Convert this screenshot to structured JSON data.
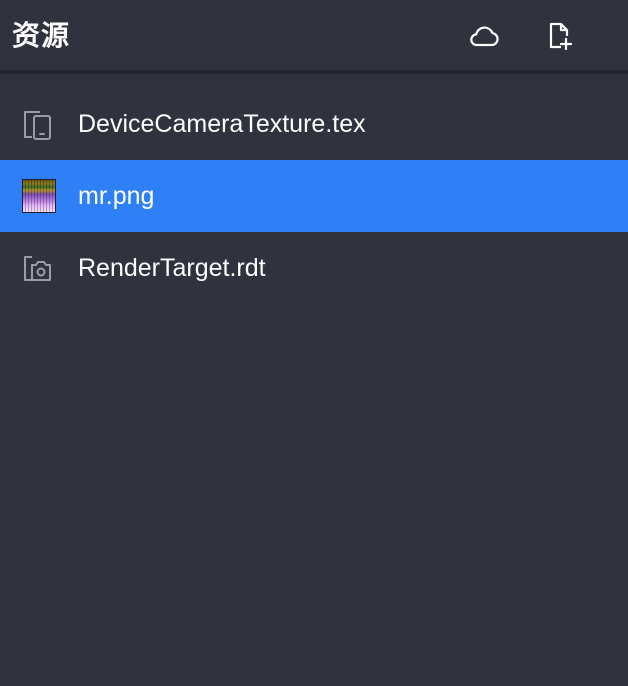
{
  "header": {
    "title": "资源"
  },
  "icons": {
    "cloud": "cloud-icon",
    "new_file": "file-plus-icon"
  },
  "files": [
    {
      "name": "DeviceCameraTexture.tex",
      "icon": "device-phone-icon",
      "selected": false
    },
    {
      "name": "mr.png",
      "icon": "image-thumbnail-icon",
      "selected": true
    },
    {
      "name": "RenderTarget.rdt",
      "icon": "camera-icon",
      "selected": false
    }
  ],
  "colors": {
    "background": "#30323d",
    "selected": "#2f80f7",
    "divider": "#26272f",
    "text": "#ffffff",
    "icon_muted": "#9a9ca6"
  }
}
